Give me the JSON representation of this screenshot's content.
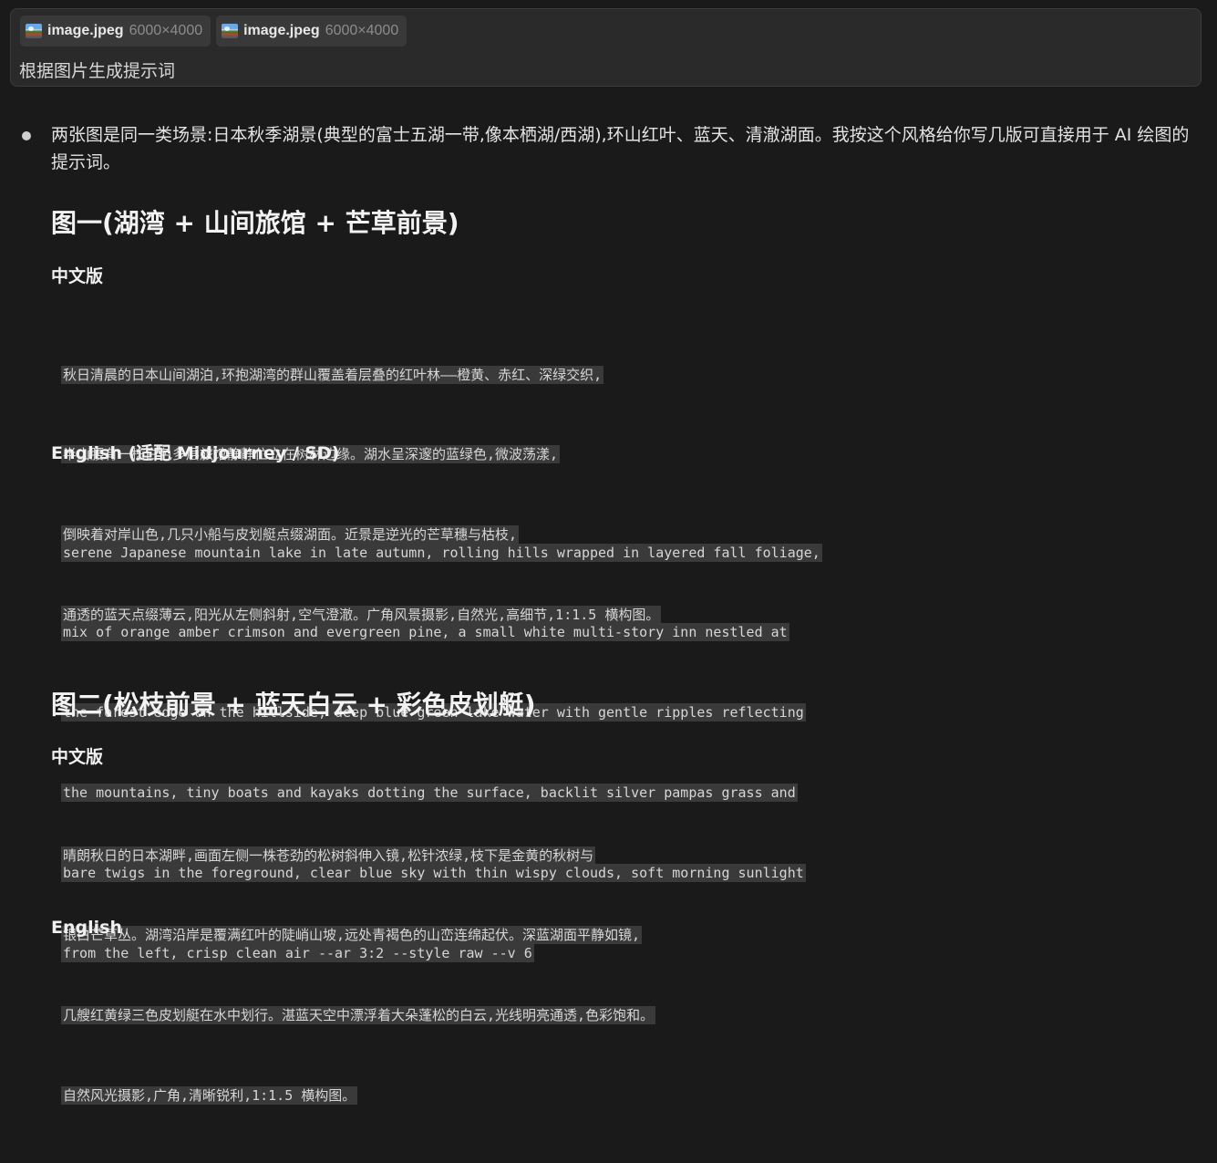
{
  "user_message": {
    "attachments": [
      {
        "name": "image.jpeg",
        "size": "6000×4000",
        "icon": "image-thumbnail-icon"
      },
      {
        "name": "image.jpeg",
        "size": "6000×4000",
        "icon": "image-thumbnail-icon"
      }
    ],
    "text": "根据图片生成提示词"
  },
  "answer": {
    "intro": "两张图是同一类场景:日本秋季湖景(典型的富士五湖一带,像本栖湖/西湖),环山红叶、蓝天、清澈湖面。我按这个风格给你写几版可直接用于 AI 绘图的提示词。",
    "section1": {
      "title": "图一(湖湾 + 山间旅馆 + 芒草前景)",
      "cn_heading": "中文版",
      "cn_lines": [
        "秋日清晨的日本山间湖泊,环抱湖湾的群山覆盖着层叠的红叶林——橙黄、赤红、深绿交织,",
        "半山腰有一栋白色多层旅馆静静伫立在树林边缘。湖水呈深邃的蓝绿色,微波荡漾,",
        "倒映着对岸山色,几只小船与皮划艇点缀湖面。近景是逆光的芒草穗与枯枝,",
        "通透的蓝天点缀薄云,阳光从左侧斜射,空气澄澈。广角风景摄影,自然光,高细节,1:1.5 横构图。"
      ],
      "en_heading": "English (适配 Midjourney / SD)",
      "en_lines": [
        "serene Japanese mountain lake in late autumn, rolling hills wrapped in layered fall foliage,",
        "mix of orange amber crimson and evergreen pine, a small white multi-story inn nestled at",
        "the forest edge on the hillside, deep blue-green lake water with gentle ripples reflecting",
        "the mountains, tiny boats and kayaks dotting the surface, backlit silver pampas grass and",
        "bare twigs in the foreground, clear blue sky with thin wispy clouds, soft morning sunlight",
        "from the left, crisp clean air --ar 3:2 --style raw --v 6"
      ]
    },
    "section2": {
      "title": "图二(松枝前景 + 蓝天白云 + 彩色皮划艇)",
      "cn_heading": "中文版",
      "cn_lines": [
        "晴朗秋日的日本湖畔,画面左侧一株苍劲的松树斜伸入镜,松针浓绿,枝下是金黄的秋树与",
        "银白芒草丛。湖湾沿岸是覆满红叶的陡峭山坡,远处青褐色的山峦连绵起伏。深蓝湖面平静如镜,",
        "几艘红黄绿三色皮划艇在水中划行。湛蓝天空中漂浮着大朵蓬松的白云,光线明亮通透,色彩饱和。",
        "自然风光摄影,广角,清晰锐利,1:1.5 横构图。"
      ],
      "en_heading_partial": "English"
    }
  }
}
